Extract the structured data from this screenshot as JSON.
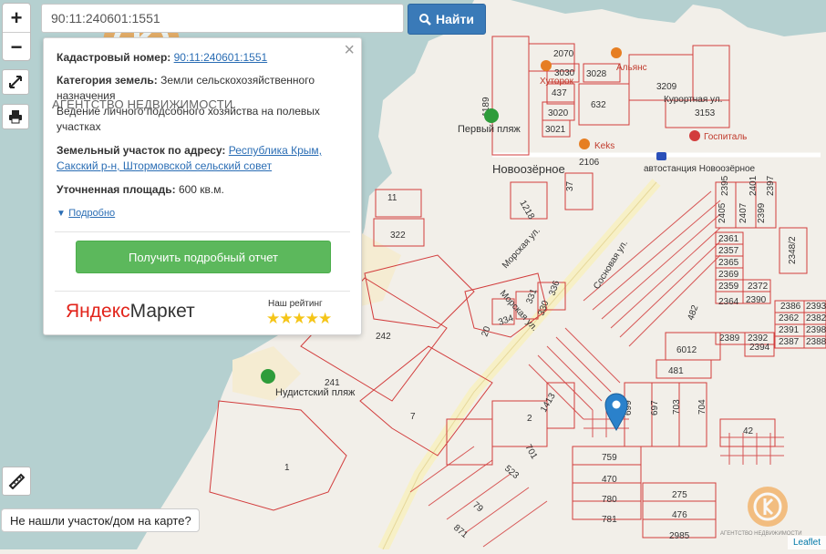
{
  "search": {
    "value": "90:11:240601:1551",
    "button_label": "Найти"
  },
  "zoom": {
    "in": "+",
    "out": "−"
  },
  "popup": {
    "cadastral_label": "Кадастровый номер:",
    "cadastral_value": "90:11:240601:1551",
    "category_label": "Категория земель:",
    "category_value": "Земли сельскохозяйственного назначения",
    "usage_value": "Ведение личного подсобного хозяйства на полевых участках",
    "address_label": "Земельный участок по адресу:",
    "address_value": "Республика Крым, Сакский р-н, Штормовской сельский совет",
    "area_label": "Уточненная площадь:",
    "area_value": "600 кв.м.",
    "details_link": "Подробно",
    "report_button": "Получить подробный отчет",
    "market_logo_part1": "Яндекс",
    "market_logo_part2": "Маркет",
    "rating_label": "Наш рейтинг",
    "rating_stars": 5,
    "close_symbol": "×"
  },
  "watermark": {
    "agency_text": "АГЕНТСТВО НЕДВИЖИМОСТИ",
    "small_agency_text": "АГЕНТСТВО НЕДВИЖИМОСТИ"
  },
  "feedback_button": "Не нашли участок/дом на карте?",
  "attribution": "Leaflet",
  "map": {
    "places": {
      "novoozernoe": "Новоозёрное",
      "first_beach": "Первый пляж",
      "nudist_beach": "Нудистский пляж",
      "bus_station": "автостанция Новоозёрное",
      "hospital": "Госпиталь",
      "pharmacy": "Хуторок",
      "alliance": "Альянс",
      "keks": "Keks",
      "kurortnaya": "Курортная ул.",
      "morskaya1": "Морская ул.",
      "morskaya2": "Морская ул.",
      "sosnovaya": "Сосновая ул."
    },
    "plots": {
      "p2070": "2070",
      "p3030": "3030",
      "p3028": "3028",
      "p437": "437",
      "p632": "632",
      "p3209": "3209",
      "p3153": "3153",
      "p1189": "1189",
      "p3020": "3020",
      "p3021": "3021",
      "p2106": "2106",
      "p1218": "1218",
      "p37": "37",
      "p11": "11",
      "p322": "322",
      "p336": "336",
      "p331": "331",
      "p330": "330",
      "p334": "334",
      "p20": "20",
      "p242": "242",
      "p241": "241",
      "p7": "7",
      "p1": "1",
      "p1413": "1413",
      "p2": "2",
      "p701": "701",
      "p523": "523",
      "p79": "79",
      "p871": "871",
      "p482": "482",
      "p6012": "6012",
      "p481": "481",
      "p699": "699",
      "p697": "697",
      "p703": "703",
      "p704": "704",
      "p42": "42",
      "p759": "759",
      "p470": "470",
      "p780": "780",
      "p781": "781",
      "p275": "275",
      "p476": "476",
      "p2985": "2985",
      "p2405": "2405",
      "p2395": "2395",
      "p2407": "2407",
      "p2401": "2401",
      "p2399": "2399",
      "p2397": "2397",
      "p2361": "2361",
      "p2357": "2357",
      "p2365": "2365",
      "p2369": "2369",
      "p2359": "2359",
      "p2372": "2372",
      "p2364": "2364",
      "p2390": "2390",
      "p2386": "2386",
      "p2393": "2393",
      "p2362": "2362",
      "p2382": "2382",
      "p2389": "2389",
      "p2392": "2392",
      "p2391": "2391",
      "p2398": "2398",
      "p2394": "2394",
      "p2387": "2387",
      "p2388": "2388",
      "p2348": "2348/2"
    }
  },
  "colors": {
    "water": "#b5d0d0",
    "land": "#f2efe9",
    "plot_stroke": "#d23c3c",
    "road": "#f7f0c6",
    "search_button": "#3a7ab8",
    "report_button": "#5cb85c",
    "marker": "#2a81cb"
  }
}
